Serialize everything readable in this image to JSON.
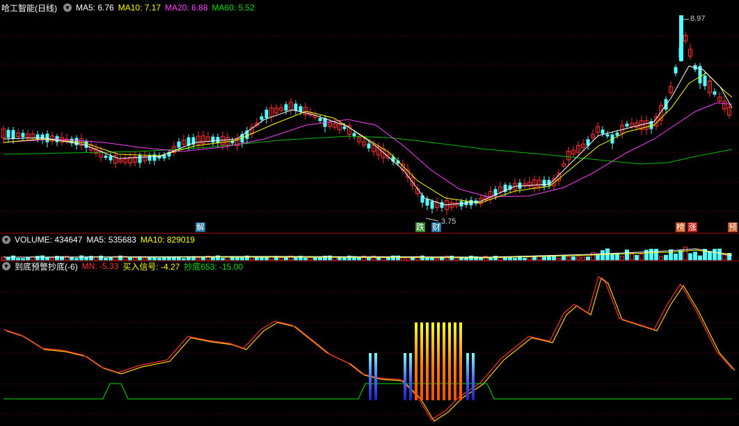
{
  "main": {
    "title": "哈工智能(日线)",
    "ma": [
      {
        "label": "MA5:",
        "value": "6.76",
        "color": "#ffffff"
      },
      {
        "label": "MA10:",
        "value": "7.17",
        "color": "#ffff00"
      },
      {
        "label": "MA20:",
        "value": "6.88",
        "color": "#ff40ff"
      },
      {
        "label": "MA60:",
        "value": "5.52",
        "color": "#00e000"
      }
    ],
    "high_label": "8.97",
    "low_label": "3.75",
    "markers": [
      {
        "text": "解",
        "bg": "#1a6fa0",
        "color": "#ffffff"
      },
      {
        "text": "跌",
        "bg": "#2f8a2f",
        "color": "#ffffff"
      },
      {
        "text": "财",
        "bg": "#1a6fa0",
        "color": "#ffffff"
      },
      {
        "text": "榜",
        "bg": "#c0501a",
        "color": "#ffffff"
      },
      {
        "text": "涨",
        "bg": "#c0201a",
        "color": "#ffffff"
      },
      {
        "text": "预",
        "bg": "#c0501a",
        "color": "#ffffff"
      }
    ]
  },
  "volume": {
    "label": "VOLUME:",
    "value": "434647",
    "ma5_label": "MA5:",
    "ma5": "535683",
    "ma10_label": "MA10:",
    "ma10": "829019"
  },
  "indicator": {
    "title": "到底预警抄底(-6)",
    "mn_label": "MN:",
    "mn": "-5.33",
    "buy_label": "买入信号:",
    "buy": "-4.27",
    "chaodi_label": "抄底653:",
    "chaodi": "-15.00"
  },
  "colors": {
    "up": "#ff3030",
    "down": "#54ffff",
    "grid": "#7a0000",
    "ma5": "#ffffff",
    "ma10": "#ffff00",
    "ma20": "#ff40ff",
    "ma60": "#00c000"
  }
}
